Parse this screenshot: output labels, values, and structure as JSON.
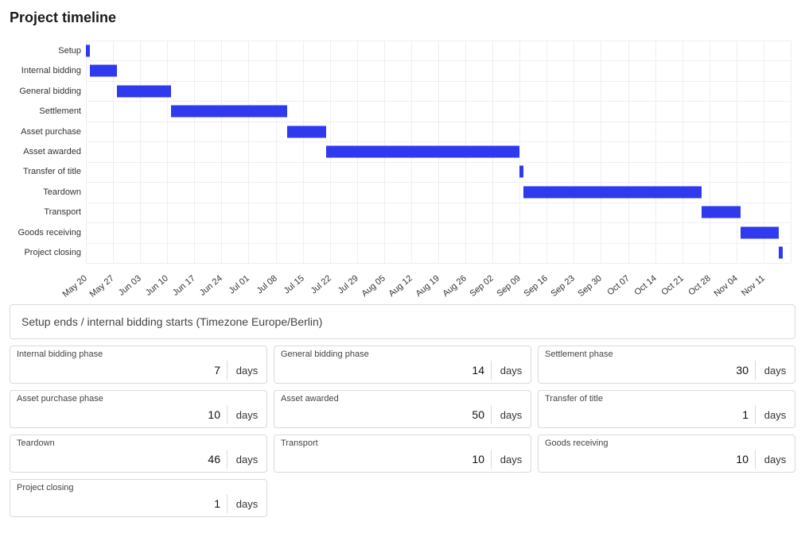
{
  "page_title": "Project timeline",
  "unit_label": "days",
  "timezone_label": "Setup ends / internal bidding starts (Timezone Europe/Berlin)",
  "phase_inputs": [
    {
      "key": "internal_bidding",
      "label": "Internal bidding phase",
      "value": 7
    },
    {
      "key": "general_bidding",
      "label": "General bidding phase",
      "value": 14
    },
    {
      "key": "settlement",
      "label": "Settlement phase",
      "value": 30
    },
    {
      "key": "asset_purchase",
      "label": "Asset purchase phase",
      "value": 10
    },
    {
      "key": "asset_awarded",
      "label": "Asset awarded",
      "value": 50
    },
    {
      "key": "transfer_of_title",
      "label": "Transfer of title",
      "value": 1
    },
    {
      "key": "teardown",
      "label": "Teardown",
      "value": 46
    },
    {
      "key": "transport",
      "label": "Transport",
      "value": 10
    },
    {
      "key": "goods_receiving",
      "label": "Goods receiving",
      "value": 10
    },
    {
      "key": "project_closing",
      "label": "Project closing",
      "value": 1
    }
  ],
  "chart_data": {
    "type": "bar",
    "orientation": "horizontal-gantt",
    "title": "Project timeline",
    "categories": [
      "Setup",
      "Internal bidding",
      "General bidding",
      "Settlement",
      "Asset purchase",
      "Asset awarded",
      "Transfer of title",
      "Teardown",
      "Transport",
      "Goods receiving",
      "Project closing"
    ],
    "x_ticks": [
      "May 20",
      "May 27",
      "Jun 03",
      "Jun 10",
      "Jun 17",
      "Jun 24",
      "Jul 01",
      "Jul 08",
      "Jul 15",
      "Jul 22",
      "Jul 29",
      "Aug 05",
      "Aug 12",
      "Aug 19",
      "Aug 26",
      "Sep 02",
      "Sep 09",
      "Sep 16",
      "Sep 23",
      "Sep 30",
      "Oct 07",
      "Oct 14",
      "Oct 21",
      "Oct 28",
      "Nov 04",
      "Nov 11"
    ],
    "x_axis": {
      "unit": "weeks_from_May20",
      "min": 0,
      "max": 26
    },
    "series": [
      {
        "name": "Setup",
        "start_week": 0.0,
        "duration_days": 1
      },
      {
        "name": "Internal bidding",
        "start_week": 0.14,
        "duration_days": 7
      },
      {
        "name": "General bidding",
        "start_week": 1.14,
        "duration_days": 14
      },
      {
        "name": "Settlement",
        "start_week": 3.14,
        "duration_days": 30
      },
      {
        "name": "Asset purchase",
        "start_week": 7.43,
        "duration_days": 10
      },
      {
        "name": "Asset awarded",
        "start_week": 8.86,
        "duration_days": 50
      },
      {
        "name": "Transfer of title",
        "start_week": 16.0,
        "duration_days": 1
      },
      {
        "name": "Teardown",
        "start_week": 16.14,
        "duration_days": 46
      },
      {
        "name": "Transport",
        "start_week": 22.71,
        "duration_days": 10
      },
      {
        "name": "Goods receiving",
        "start_week": 24.14,
        "duration_days": 10
      },
      {
        "name": "Project closing",
        "start_week": 25.57,
        "duration_days": 1
      }
    ]
  }
}
